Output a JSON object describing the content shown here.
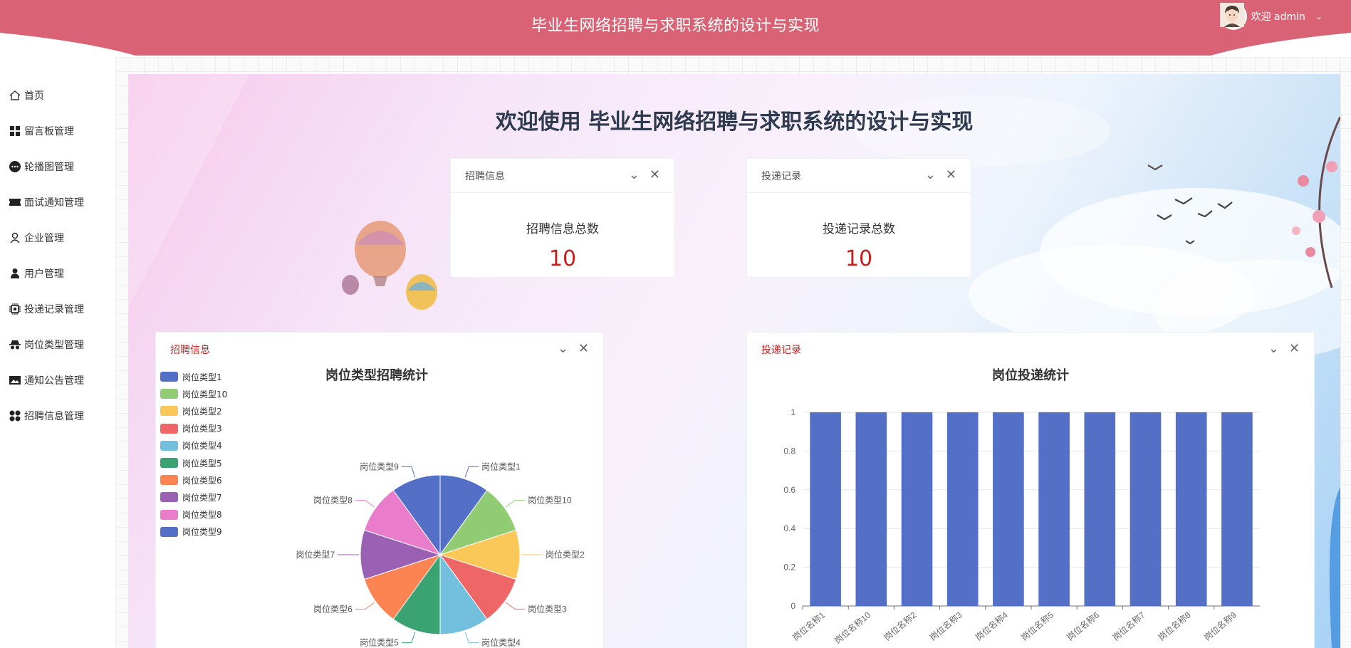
{
  "header": {
    "title": "毕业生网络招聘与求职系统的设计与实现",
    "welcome_user": "欢迎 admin"
  },
  "sidebar": {
    "items": [
      {
        "label": "首页",
        "icon": "home-icon"
      },
      {
        "label": "留言板管理",
        "icon": "grid-icon"
      },
      {
        "label": "轮播图管理",
        "icon": "more-circle-icon"
      },
      {
        "label": "面试通知管理",
        "icon": "ticket-icon"
      },
      {
        "label": "企业管理",
        "icon": "user-outline-icon"
      },
      {
        "label": "用户管理",
        "icon": "user-solid-icon"
      },
      {
        "label": "投递记录管理",
        "icon": "chip-icon"
      },
      {
        "label": "岗位类型管理",
        "icon": "incognito-icon"
      },
      {
        "label": "通知公告管理",
        "icon": "picture-icon"
      },
      {
        "label": "招聘信息管理",
        "icon": "four-dots-icon"
      }
    ]
  },
  "main": {
    "welcome": "欢迎使用 毕业生网络招聘与求职系统的设计与实现",
    "stat_cards": [
      {
        "title": "招聘信息",
        "label": "招聘信息总数",
        "value": "10"
      },
      {
        "title": "投递记录",
        "label": "投递记录总数",
        "value": "10"
      }
    ],
    "chart_cards": [
      {
        "title": "招聘信息"
      },
      {
        "title": "投递记录"
      }
    ],
    "colors": {
      "header": "#d96374",
      "accent_red": "#c81e1e",
      "bar": "#5470c6"
    }
  },
  "chart_data": [
    {
      "type": "pie",
      "title": "岗位类型招聘统计",
      "categories": [
        "岗位类型1",
        "岗位类型10",
        "岗位类型2",
        "岗位类型3",
        "岗位类型4",
        "岗位类型5",
        "岗位类型6",
        "岗位类型7",
        "岗位类型8",
        "岗位类型9"
      ],
      "values": [
        1,
        1,
        1,
        1,
        1,
        1,
        1,
        1,
        1,
        1
      ],
      "colors": [
        "#5470c6",
        "#91cc75",
        "#fac858",
        "#ee6666",
        "#73c0de",
        "#3ba272",
        "#fc8452",
        "#9a60b4",
        "#ea7ccc",
        "#5470c6"
      ],
      "legend": "left"
    },
    {
      "type": "bar",
      "title": "岗位投递统计",
      "categories": [
        "岗位名称1",
        "岗位名称10",
        "岗位名称2",
        "岗位名称3",
        "岗位名称4",
        "岗位名称5",
        "岗位名称6",
        "岗位名称7",
        "岗位名称8",
        "岗位名称9"
      ],
      "values": [
        1,
        1,
        1,
        1,
        1,
        1,
        1,
        1,
        1,
        1
      ],
      "ylim": [
        0,
        1
      ],
      "yticks": [
        "0",
        "0.2",
        "0.4",
        "0.6",
        "0.8",
        "1"
      ],
      "grid": true
    }
  ]
}
